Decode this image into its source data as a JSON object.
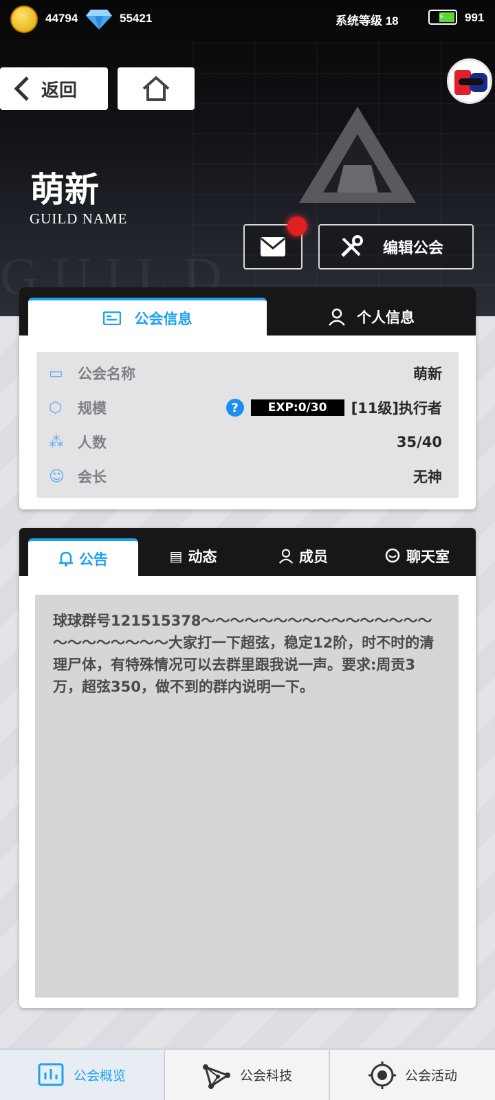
{
  "status_bar": {
    "coins": "44794",
    "diamonds": "55421",
    "system_level": "系统等级 18",
    "energy": "991"
  },
  "header": {
    "back_label": "返回",
    "guild_name": "萌新",
    "guild_name_caption": "GUILD NAME",
    "edit_guild_label": "编辑公会"
  },
  "info_panel": {
    "tabs": [
      {
        "label": "公会信息",
        "active": true
      },
      {
        "label": "个人信息",
        "active": false
      }
    ],
    "rows": [
      {
        "label": "公会名称",
        "value": "萌新",
        "icon": "id-card-icon"
      },
      {
        "label": "规模",
        "exp": "EXP:0/30",
        "value": "[11级]执行者",
        "icon": "cube-icon"
      },
      {
        "label": "人数",
        "value": "35/40",
        "icon": "people-icon"
      },
      {
        "label": "会长",
        "value": "无神",
        "icon": "leader-icon"
      }
    ]
  },
  "announce_panel": {
    "tabs": [
      {
        "label": "公告",
        "active": true,
        "icon": "bell-icon"
      },
      {
        "label": "动态",
        "active": false,
        "icon": "note-icon"
      },
      {
        "label": "成员",
        "active": false,
        "icon": "person-icon"
      },
      {
        "label": "聊天室",
        "active": false,
        "icon": "chat-icon"
      }
    ],
    "text": "球球群号121515378～～～～～～～～～～～～～～～～～～～～～～～～大家打一下超弦，稳定12阶，时不时的清理尸体，有特殊情况可以去群里跟我说一声。要求:周贡3万，超弦350，做不到的群内说明一下。"
  },
  "bottom_nav": {
    "items": [
      {
        "label": "公会概览",
        "active": true,
        "icon": "chart-icon"
      },
      {
        "label": "公会科技",
        "active": false,
        "icon": "network-icon"
      },
      {
        "label": "公会活动",
        "active": false,
        "icon": "target-icon"
      }
    ]
  },
  "colors": {
    "accent": "#1da1f2",
    "notification": "#e02020"
  }
}
